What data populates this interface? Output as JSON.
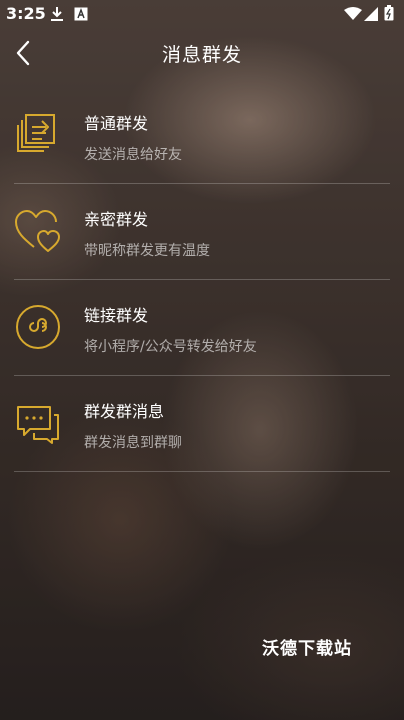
{
  "status_bar": {
    "time": "3:25",
    "icons": [
      "download-icon",
      "text-box-icon",
      "wifi-icon",
      "signal-icon",
      "battery-icon"
    ]
  },
  "header": {
    "title": "消息群发",
    "back_icon": "chevron-left-icon"
  },
  "colors": {
    "accent_gold": "#d7a92e"
  },
  "items": [
    {
      "title": "普通群发",
      "subtitle": "发送消息给好友",
      "icon": "forward-messages-icon"
    },
    {
      "title": "亲密群发",
      "subtitle": "带昵称群发更有温度",
      "icon": "hearts-icon"
    },
    {
      "title": "链接群发",
      "subtitle": "将小程序/公众号转发给好友",
      "icon": "link-circle-icon"
    },
    {
      "title": "群发群消息",
      "subtitle": "群发消息到群聊",
      "icon": "group-chat-icon"
    }
  ],
  "watermark": "沃德下载站"
}
